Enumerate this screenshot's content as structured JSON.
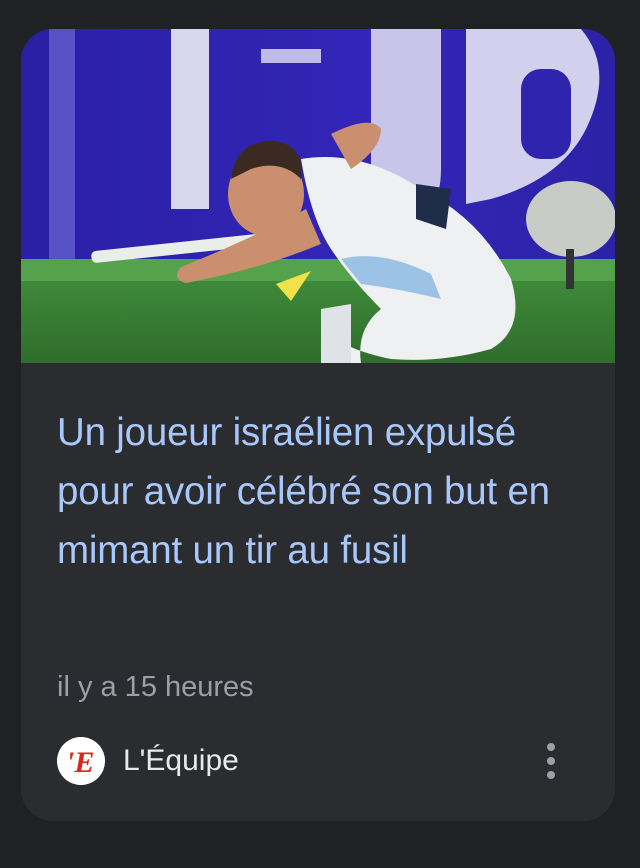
{
  "card": {
    "headline": "Un joueur israélien expulsé pour avoir célébré son but en mimant un tir au fusil",
    "time_ago": "il y a 15 heures",
    "source": {
      "name": "L'Équipe",
      "logo_letter": "'E",
      "logo_color": "#e2231a"
    },
    "menu_icon": "more-vert-icon"
  },
  "colors": {
    "background": "#202124",
    "card": "#2b2c30",
    "headline": "#a8c7fa",
    "meta": "#9aa0a6",
    "source_text": "#e8eaed"
  }
}
